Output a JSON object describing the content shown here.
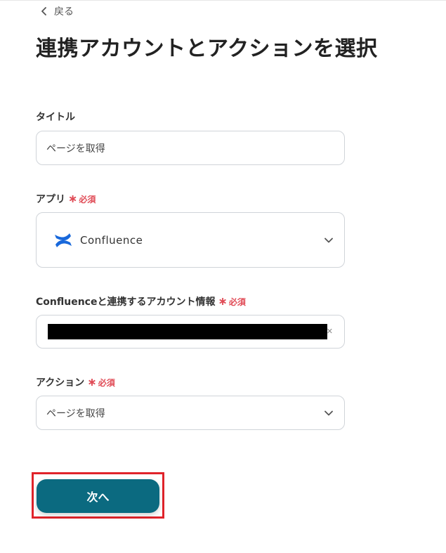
{
  "nav": {
    "back_label": "戻る"
  },
  "page": {
    "title": "連携アカウントとアクションを選択"
  },
  "form": {
    "title_field": {
      "label": "タイトル",
      "value": "ページを取得"
    },
    "app_field": {
      "label": "アプリ",
      "required": "必須",
      "value": "Confluence",
      "icon": "confluence-logo-icon"
    },
    "account_field": {
      "label": "Confluenceと連携するアカウント情報",
      "required": "必須"
    },
    "action_field": {
      "label": "アクション",
      "required": "必須",
      "value": "ページを取得"
    }
  },
  "actions": {
    "next_label": "次へ"
  },
  "colors": {
    "primary": "#0b6a80",
    "required": "#e04b56",
    "highlight": "#e0232a",
    "confluence_blue": "#1868db"
  }
}
